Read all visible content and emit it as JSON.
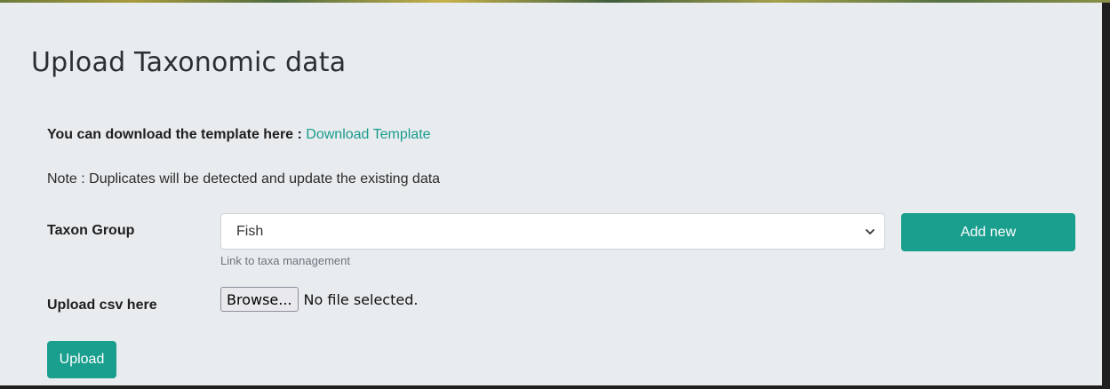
{
  "page": {
    "title": "Upload Taxonomic data"
  },
  "download": {
    "label": "You can download the template here : ",
    "link_text": "Download Template"
  },
  "note": "Note : Duplicates will be detected and update the existing data",
  "taxon_group": {
    "label": "Taxon Group",
    "selected": "Fish",
    "help_link": "Link to taxa management",
    "add_new_label": "Add new"
  },
  "upload_csv": {
    "label": "Upload csv here",
    "browse_label": "Browse...",
    "file_status": "No file selected."
  },
  "upload_button": "Upload",
  "colors": {
    "accent": "#1a9e8e",
    "link": "#1a9b8c",
    "panel_bg": "#e8ecef"
  }
}
